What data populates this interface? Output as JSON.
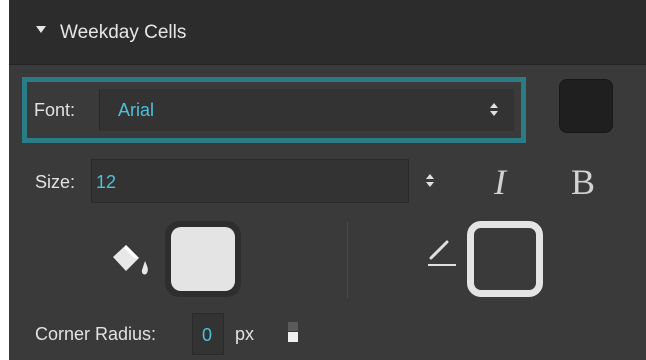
{
  "section": {
    "title": "Weekday Cells"
  },
  "font": {
    "label": "Font:",
    "value": "Arial",
    "focus_color": "#2a7c86",
    "color_swatch": "#1f1f1f"
  },
  "size": {
    "label": "Size:",
    "value": "12",
    "italic_label": "I",
    "bold_label": "B"
  },
  "fill": {
    "icon": "paint-bucket-icon",
    "color": "#e4e4e4"
  },
  "border": {
    "icon": "pen-icon",
    "color": "#e4e4e4"
  },
  "corner_radius": {
    "label": "Corner Radius:",
    "value": "0",
    "unit": "px"
  },
  "accent_value_color": "#4fc0d8"
}
